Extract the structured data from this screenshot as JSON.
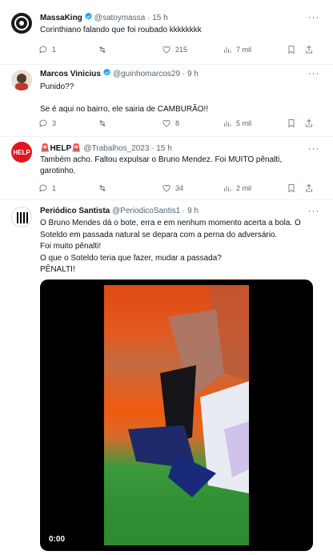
{
  "tweets": [
    {
      "name": "MassaKing",
      "handle": "@satoymassa · 15 h",
      "text": "Corinthiano falando que foi roubado kkkkkkkk",
      "replies": "1",
      "retweets": "",
      "likes": "215",
      "views": "7 mil"
    },
    {
      "name": "Marcos Vinicius",
      "handle": "@guinhomarcos29 · 9 h",
      "text": "Punido??\n\nSe é aqui no bairro, ele sairia de CAMBURÃO!!",
      "replies": "3",
      "retweets": "",
      "likes": "8",
      "views": "5 mil"
    },
    {
      "name": "🚨HELP🚨",
      "handle": "@Trabalhos_2023 · 15 h",
      "text": "Também acho. Faltou expulsar o Bruno Mendez. Foi MUITO pênalti,\ngarotinho.",
      "replies": "1",
      "retweets": "",
      "likes": "34",
      "views": "2 mil"
    },
    {
      "name": "Periódico Santista",
      "handle": "@PeriodicoSantis1 · 9 h",
      "text": "O Bruno Mendes dá o bote, erra e em nenhum momento acerta a bola. O\nSoteldo em passada natural se depara com a perna do adversário.\nFoi muito pênalti!\nO que o Soteldo teria que fazer, mudar a passada?\nPÊNALTI!"
    }
  ],
  "video": {
    "time": "0:00"
  },
  "colors": {
    "verified": "#1d9bf0",
    "muted": "#536471",
    "divider": "#eff3f4"
  }
}
